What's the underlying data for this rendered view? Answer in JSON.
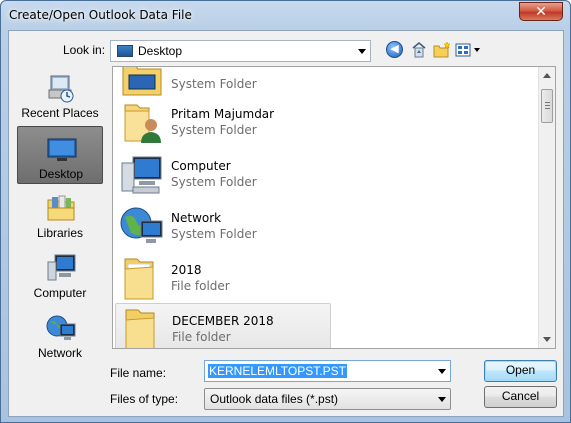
{
  "window": {
    "title": "Create/Open Outlook Data File",
    "close_glyph": "✕"
  },
  "toolbar": {
    "look_in_label": "Look in:",
    "look_in_value": "Desktop",
    "icons": [
      "back-icon",
      "up-folder-icon",
      "new-folder-icon",
      "views-icon"
    ]
  },
  "places": [
    {
      "label": "Recent Places",
      "icon": "recent-places-icon"
    },
    {
      "label": "Desktop",
      "icon": "desktop-icon",
      "selected": true
    },
    {
      "label": "Libraries",
      "icon": "libraries-icon"
    },
    {
      "label": "Computer",
      "icon": "computer-icon"
    },
    {
      "label": "Network",
      "icon": "network-icon"
    }
  ],
  "files": [
    {
      "name": "",
      "type": "System Folder",
      "icon": "system-folder-icon"
    },
    {
      "name": "Pritam Majumdar",
      "type": "System Folder",
      "icon": "user-folder-icon"
    },
    {
      "name": "Computer",
      "type": "System Folder",
      "icon": "computer-icon"
    },
    {
      "name": "Network",
      "type": "System Folder",
      "icon": "network-icon"
    },
    {
      "name": "2018",
      "type": "File folder",
      "icon": "folder-icon"
    },
    {
      "name": "DECEMBER 2018",
      "type": "File folder",
      "icon": "folder-icon",
      "hover": true
    }
  ],
  "bottom": {
    "file_name_label": "File name:",
    "file_name_value": "KERNELEMLTOPST.PST",
    "files_of_type_label": "Files of type:",
    "files_of_type_value": "Outlook data files (*.pst)",
    "open_label": "Open",
    "cancel_label": "Cancel"
  },
  "colors": {
    "selection": "#3399ff",
    "titlebar": "#b9cfe6",
    "close": "#c0382a"
  }
}
